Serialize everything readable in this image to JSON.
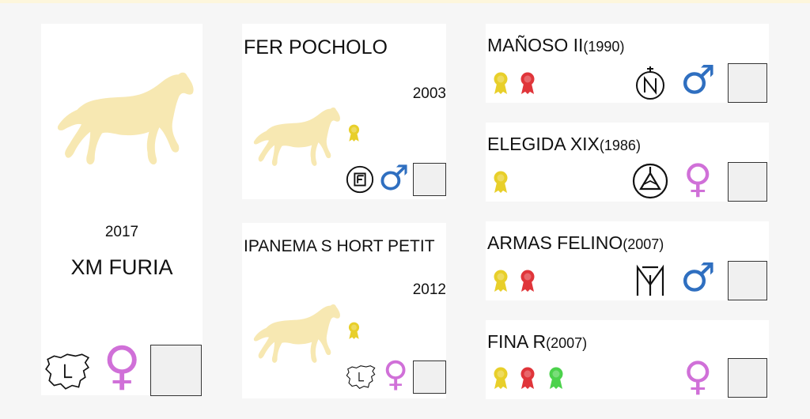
{
  "colors": {
    "horse_fill": "#f7e8b2",
    "male": "#2f6fc0",
    "female": "#d070d8",
    "ribbon_gold": "#e8cf2a",
    "ribbon_red": "#e0353a",
    "ribbon_green": "#4cd24c"
  },
  "main": {
    "year": "2017",
    "name": "XM FURIA",
    "sex_symbol": "♀",
    "brand_icon": "map-l-brand-icon"
  },
  "parents": [
    {
      "name": "FER POCHOLO",
      "year": "2003",
      "ribbons": [
        "gold"
      ],
      "brand_icon": "f-circle-brand-icon",
      "sex_symbol": "♂"
    },
    {
      "name": "IPANEMA S HORT PETIT",
      "year": "2012",
      "ribbons": [
        "gold"
      ],
      "brand_icon": "map-l-brand-icon",
      "sex_symbol": "♀"
    }
  ],
  "grandparents": [
    {
      "name": "MAÑOSO II",
      "year": "(1990)",
      "ribbons": [
        "gold",
        "red"
      ],
      "brand_icon": "n-circle-brand-icon",
      "sex_symbol": "♂"
    },
    {
      "name": "ELEGIDA XIX",
      "year": "(1986)",
      "ribbons": [
        "gold"
      ],
      "brand_icon": "triangle-circle-brand-icon",
      "sex_symbol": "♀"
    },
    {
      "name": "ARMAS FELINO",
      "year": "(2007)",
      "ribbons": [
        "gold",
        "red"
      ],
      "brand_icon": "mt-brand-icon",
      "sex_symbol": "♂"
    },
    {
      "name": "FINA R",
      "year": "(2007)",
      "ribbons": [
        "gold",
        "red",
        "green"
      ],
      "brand_icon": "",
      "sex_symbol": "♀"
    }
  ]
}
